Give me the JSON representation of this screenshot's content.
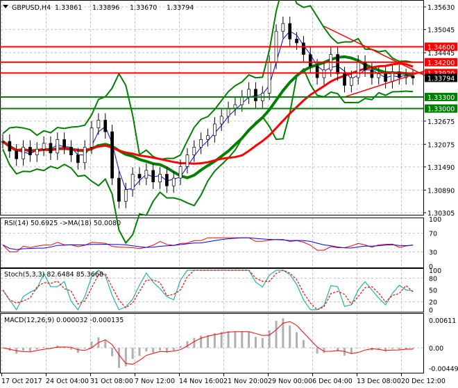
{
  "header": {
    "symbol": "GBPUSD,H4",
    "open": "1.33861",
    "high": "1.33896",
    "low": "1.33670",
    "close": "1.33794"
  },
  "rsi_label": "RSI(14) 50.6925  ->MA(18) 50.0080",
  "stoch_label": "Stoch(5,3,3) 82.6484 85.3668",
  "macd_label": "MACD(12,26,9) 0.000032 -0.000135",
  "chart_data": {
    "type": "candlestick",
    "symbol": "GBPUSD",
    "timeframe": "H4",
    "x_ticks": [
      "17 Oct 2017",
      "24 Oct 04:00",
      "31 Oct 08:00",
      "7 Nov 12:00",
      "14 Nov 16:00",
      "21 Nov 20:00",
      "29 Nov 00:00",
      "6 Dec 04:00",
      "13 Dec 08:00",
      "20 Dec 12:00"
    ],
    "y_ticks": [
      "1.35630",
      "1.35045",
      "1.34445",
      "1.32675",
      "1.32075",
      "1.31490",
      "1.30890",
      "1.30305"
    ],
    "ylim": [
      1.30305,
      1.3563
    ],
    "closes": [
      1.3215,
      1.319,
      1.317,
      1.32,
      1.318,
      1.3195,
      1.321,
      1.3185,
      1.322,
      1.32,
      1.318,
      1.316,
      1.32,
      1.325,
      1.327,
      1.324,
      1.312,
      1.306,
      1.309,
      1.313,
      1.312,
      1.314,
      1.311,
      1.313,
      1.31,
      1.312,
      1.315,
      1.318,
      1.32,
      1.322,
      1.323,
      1.326,
      1.328,
      1.33,
      1.331,
      1.333,
      1.335,
      1.332,
      1.334,
      1.342,
      1.35,
      1.352,
      1.348,
      1.347,
      1.344,
      1.341,
      1.338,
      1.34,
      1.344,
      1.339,
      1.336,
      1.338,
      1.342,
      1.34,
      1.338,
      1.339,
      1.337,
      1.3395,
      1.338,
      1.3385,
      1.3379
    ],
    "levels": [
      {
        "price": "1.34600",
        "color": "#ff0000"
      },
      {
        "price": "1.34200",
        "color": "#ff0000"
      },
      {
        "price": "1.33920",
        "color": "#ff0000"
      },
      {
        "price": "1.33300",
        "color": "#008000"
      },
      {
        "price": "1.33000",
        "color": "#008000"
      }
    ],
    "current_price": "1.33794",
    "trendlines": [
      {
        "from": [
          47,
          1.3513
        ],
        "to": [
          61,
          1.3385
        ],
        "color": "#ff0000"
      },
      {
        "from": [
          50,
          1.333
        ],
        "to": [
          61,
          1.3398
        ],
        "color": "#ff0000"
      }
    ],
    "rsi": {
      "ylim": [
        0,
        100
      ],
      "ticks": [
        "100",
        "70",
        "30",
        "0"
      ]
    },
    "stoch": {
      "ylim": [
        0,
        100
      ],
      "ticks": [
        "100",
        "80",
        "50",
        "20",
        "0"
      ]
    },
    "macd": {
      "ticks": [
        "0.00611",
        "0.00",
        "-0.004499"
      ]
    },
    "colors": {
      "bull": "#008000",
      "bear": "#000000",
      "ma_slow": "#ff0000",
      "ma_mid": "#008000",
      "bands": "#008000",
      "rsi": "#ff0000",
      "rsi_ma": "#0000ff",
      "stoch_main": "#20b2aa",
      "stoch_signal": "#ff0000"
    }
  }
}
